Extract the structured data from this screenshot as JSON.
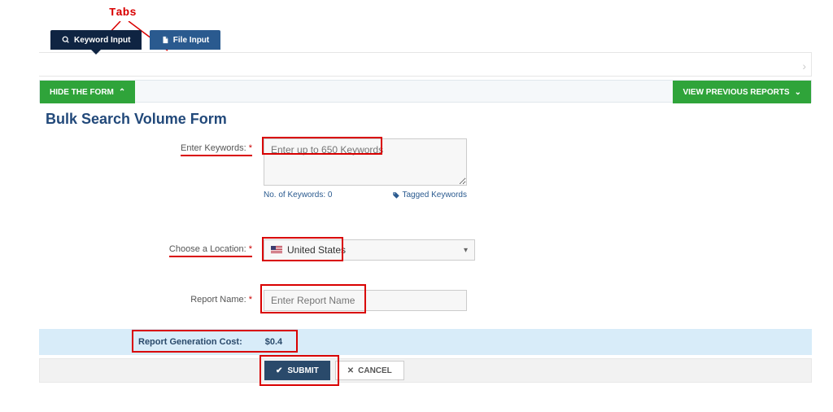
{
  "annotation": {
    "tabs_label": "Tabs"
  },
  "tabs": {
    "keyword_input": "Keyword Input",
    "file_input": "File Input"
  },
  "toolbar": {
    "hide_form": "HIDE THE FORM",
    "view_previous": "VIEW PREVIOUS REPORTS"
  },
  "title": "Bulk Search Volume Form",
  "form": {
    "keywords_label": "Enter Keywords:",
    "keywords_placeholder": "Enter up to 650 Keywords",
    "keywords_count_label": "No. of Keywords: 0",
    "tagged_keywords_label": "Tagged Keywords",
    "location_label": "Choose a Location:",
    "location_selected": "United States",
    "report_name_label": "Report Name:",
    "report_name_placeholder": "Enter Report Name"
  },
  "cost": {
    "label": "Report Generation Cost:",
    "value": "$0.4"
  },
  "actions": {
    "submit": "SUBMIT",
    "cancel": "CANCEL"
  }
}
